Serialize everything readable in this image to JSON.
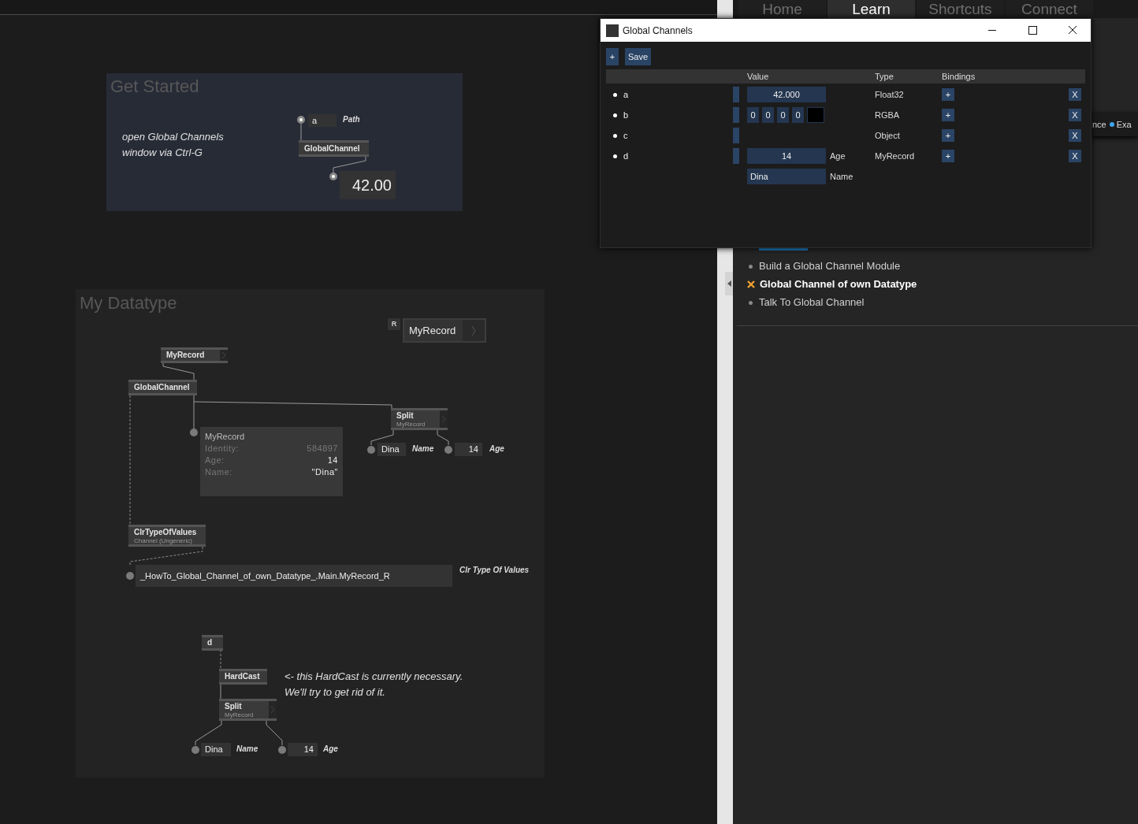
{
  "get_started": {
    "title": "Get Started",
    "comment": "open Global Channels\nwindow via Ctrl-G",
    "input": {
      "value": "a",
      "label": "Path"
    },
    "node": {
      "title": "GlobalChannel"
    },
    "output": {
      "value": "42.00"
    }
  },
  "my_datatype": {
    "title": "My Datatype",
    "type_node": {
      "badge": "R",
      "title": "MyRecord"
    },
    "nodes": [
      {
        "title": "MyRecord",
        "expandable": true
      },
      {
        "title": "GlobalChannel",
        "expandable": false
      },
      {
        "title": "Split",
        "subtitle": "MyRecord",
        "expandable": true
      },
      {
        "title": "ClrTypeOfValues",
        "subtitle": "Channel (Ungeneric)",
        "expandable": false
      },
      {
        "title": "d",
        "expandable": false
      },
      {
        "title": "HardCast",
        "expandable": false
      },
      {
        "title": "Split",
        "subtitle": "MyRecord",
        "expandable": true
      }
    ],
    "tooltip": {
      "title": "MyRecord",
      "rows": [
        {
          "label": "Identity:",
          "value": "584897",
          "muted": true
        },
        {
          "label": "Age:",
          "value": "14",
          "muted": false
        },
        {
          "label": "Name:",
          "value": "\"Dina\"",
          "muted": false
        }
      ]
    },
    "outputs": [
      {
        "value": "Dina",
        "label": "Name",
        "kind": "string"
      },
      {
        "value": "14",
        "label": "Age",
        "kind": "number"
      },
      {
        "value": "_HowTo_Global_Channel_of_own_Datatype_.Main.MyRecord_R",
        "label": "Clr Type Of Values",
        "kind": "string"
      },
      {
        "value": "Dina",
        "label": "Name",
        "kind": "string"
      },
      {
        "value": "14",
        "label": "Age",
        "kind": "number"
      }
    ],
    "comment": "<- this HardCast is currently necessary.\nWe'll try to get rid of it."
  },
  "right_panel": {
    "tabs": [
      {
        "label": "Home",
        "selected": false
      },
      {
        "label": "Learn",
        "selected": true
      },
      {
        "label": "Shortcuts",
        "selected": false
      },
      {
        "label": "Connect",
        "selected": false
      }
    ],
    "sub_tabs": [
      {
        "label": "nce",
        "new": false
      },
      {
        "label": "Exa",
        "new": true
      }
    ],
    "lessons": [
      {
        "label": "Build a Global Channel Module",
        "selected": false
      },
      {
        "label": "Global Channel of own Datatype",
        "selected": true
      },
      {
        "label": "Talk To Global Channel",
        "selected": false
      }
    ]
  },
  "window": {
    "title": "Global Channels",
    "toolbar": [
      "+",
      "Save"
    ],
    "columns": [
      "Value",
      "Type",
      "Bindings"
    ],
    "channels": [
      {
        "name": "a",
        "kind": "number",
        "value": "42.000",
        "type": "Float32",
        "add": "+",
        "remove": "X"
      },
      {
        "name": "b",
        "kind": "color",
        "components": [
          "0",
          "0",
          "0",
          "0"
        ],
        "type": "RGBA",
        "add": "+",
        "remove": "X"
      },
      {
        "name": "c",
        "kind": "object",
        "type": "Object",
        "add": "+",
        "remove": "X"
      },
      {
        "name": "d",
        "kind": "record",
        "fields": [
          {
            "value": "14",
            "label": "Age",
            "kind": "number"
          },
          {
            "value": "Dina",
            "label": "Name",
            "kind": "string"
          }
        ],
        "type": "MyRecord",
        "add": "+",
        "remove": "X"
      }
    ]
  }
}
